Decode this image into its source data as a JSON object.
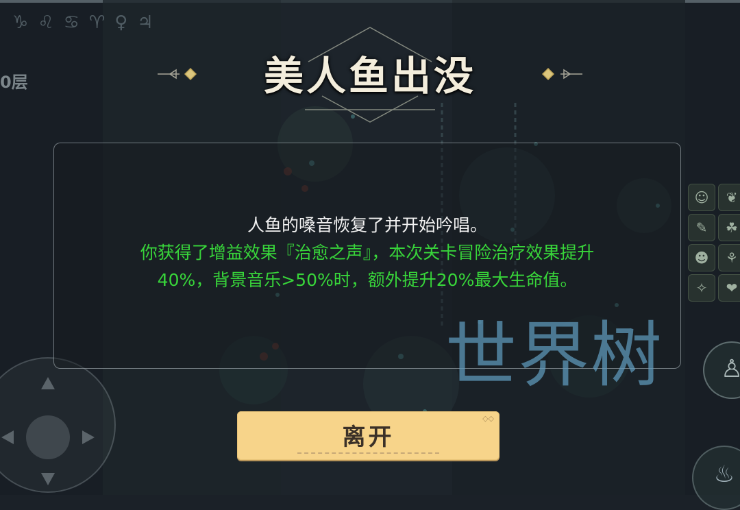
{
  "hud": {
    "top_icons": [
      "♑",
      "♌",
      "♋",
      "♈",
      "♀",
      "♃"
    ],
    "floor_label": "0层",
    "right_icons": [
      "☺",
      "❦",
      "✎",
      "☘",
      "☻",
      "⚘",
      "✧",
      "❤"
    ],
    "avatar_icon": "♙",
    "skill_icon": "♨"
  },
  "event": {
    "title": "美人鱼出没",
    "line1": "人鱼的嗓音恢复了并开始吟唱。",
    "line2": "你获得了增益效果『治愈之声』，本次关卡冒险治疗效果提升",
    "line3": "40%，背景音乐>50%时，额外提升20%最大生命值。"
  },
  "actions": {
    "leave_label": "离开"
  },
  "watermark": "世界树",
  "colors": {
    "background": "#1b2128",
    "green_text": "#38d53a",
    "button_fill": "#f7d48a",
    "watermark": "#5f9bbe"
  }
}
